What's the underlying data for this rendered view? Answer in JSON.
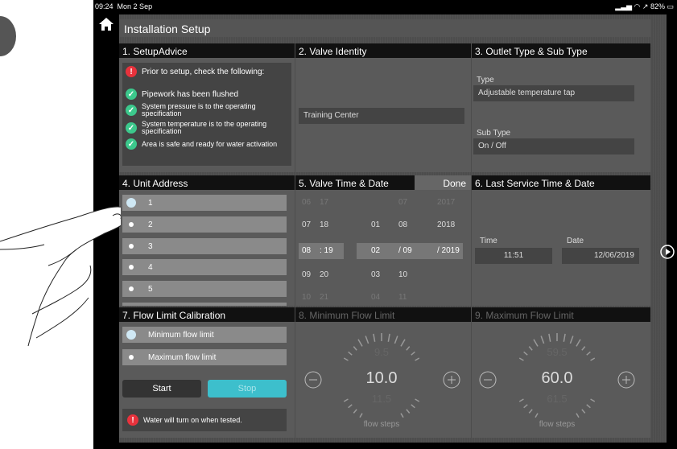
{
  "status": {
    "time": "09:24",
    "date": "Mon 2 Sep",
    "battery": "82%"
  },
  "title": "Installation Setup",
  "panels": {
    "setup_advice": {
      "title": "1. SetupAdvice",
      "warning": "Prior to setup, check the following:",
      "checks": [
        "Pipework has been flushed",
        "System pressure is to the operating specification",
        "System temperature is to the operating specification",
        "Area is safe and ready for water activation"
      ]
    },
    "valve_identity": {
      "title": "2. Valve Identity",
      "value": "Training Center"
    },
    "outlet": {
      "title": "3. Outlet Type & Sub Type",
      "type_label": "Type",
      "type_value": "Adjustable temperature tap",
      "subtype_label": "Sub Type",
      "subtype_value": "On / Off"
    },
    "unit_address": {
      "title": "4. Unit Address",
      "items": [
        "1",
        "2",
        "3",
        "4",
        "5"
      ]
    },
    "valve_time": {
      "title": "5. Valve Time & Date",
      "done": "Done",
      "rows": [
        {
          "h": "06",
          "m": "17",
          "d": "",
          "mo": "07",
          "y": "2017"
        },
        {
          "h": "07",
          "m": "18",
          "d": "01",
          "mo": "08",
          "y": "2018"
        },
        {
          "h": "08",
          "m": "19",
          "d": "02",
          "mo": "09",
          "y": "2019"
        },
        {
          "h": "09",
          "m": "20",
          "d": "03",
          "mo": "10",
          "y": ""
        },
        {
          "h": "10",
          "m": "21",
          "d": "04",
          "mo": "11",
          "y": ""
        }
      ]
    },
    "last_service": {
      "title": "6. Last Service Time & Date",
      "time_label": "Time",
      "time_value": "11:51",
      "date_label": "Date",
      "date_value": "12/06/2019"
    },
    "flow_cal": {
      "title": "7. Flow Limit Calibration",
      "options": [
        "Minimum flow limit",
        "Maximum flow limit"
      ],
      "start": "Start",
      "stop": "Stop",
      "note": "Water will turn on when tested."
    },
    "min_flow": {
      "title": "8. Minimum Flow Limit",
      "value": "10.0",
      "above": "9.5",
      "below": "11.5",
      "unit": "flow steps"
    },
    "max_flow": {
      "title": "9. Maximum Flow Limit",
      "value": "60.0",
      "above": "59.5",
      "below": "61.5",
      "unit": "flow steps"
    }
  },
  "colors": {
    "accent": "#3dbfcc",
    "ok": "#3cc88c",
    "warn": "#e8323c"
  }
}
